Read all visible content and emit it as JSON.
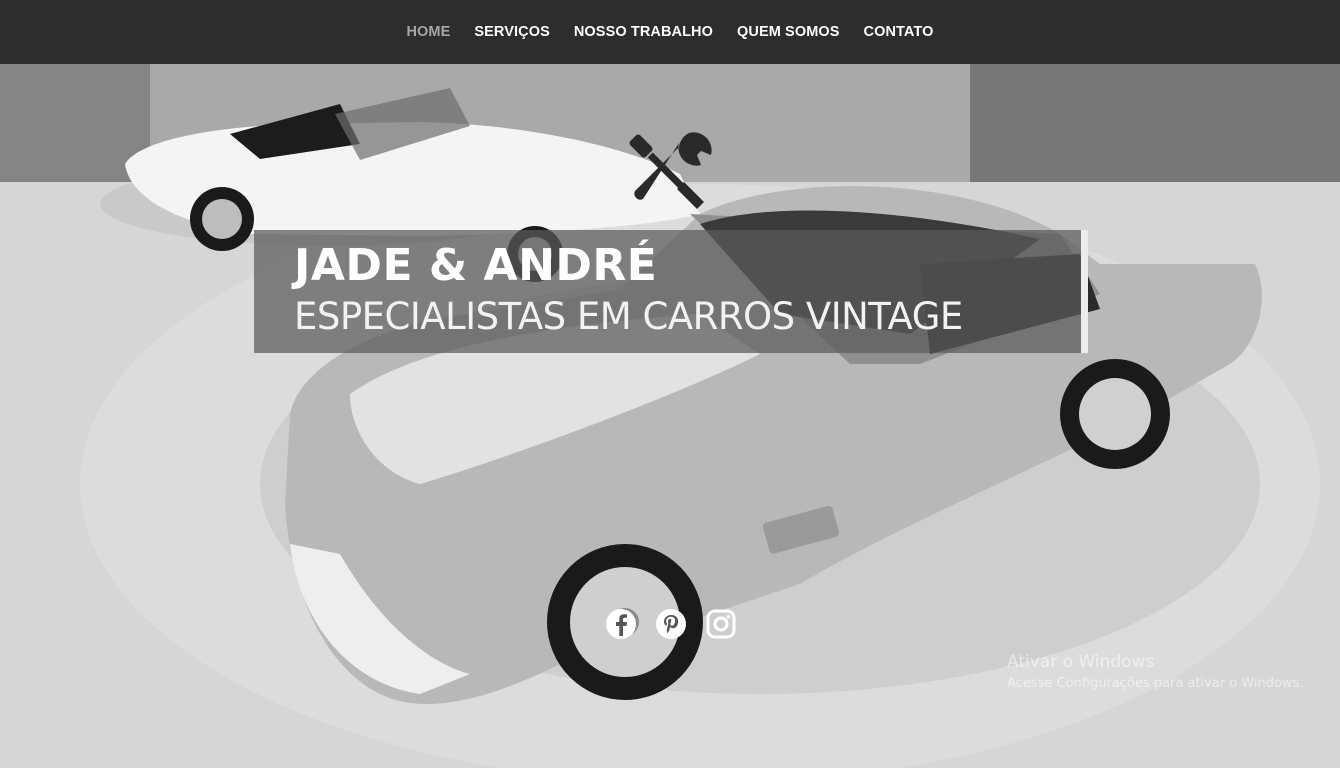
{
  "nav": {
    "items": [
      {
        "label": "HOME",
        "active": true
      },
      {
        "label": "SERVIÇOS",
        "active": false
      },
      {
        "label": "NOSSO TRABALHO",
        "active": false
      },
      {
        "label": "QUEM SOMOS",
        "active": false
      },
      {
        "label": "CONTATO",
        "active": false
      }
    ]
  },
  "hero": {
    "icon": "wrench-screwdriver-icon",
    "title": "JADE & ANDRÉ",
    "subtitle": "ESPECIALISTAS EM CARROS VINTAGE"
  },
  "social": {
    "icons": [
      "facebook-icon",
      "pinterest-icon",
      "instagram-icon"
    ]
  },
  "watermark": {
    "line1": "Ativar o Windows",
    "line2": "Acesse Configurações para ativar o Windows."
  },
  "colors": {
    "nav_bg": "#2d2d2d",
    "nav_active": "#a6a6a6",
    "nav_text": "#ffffff"
  }
}
